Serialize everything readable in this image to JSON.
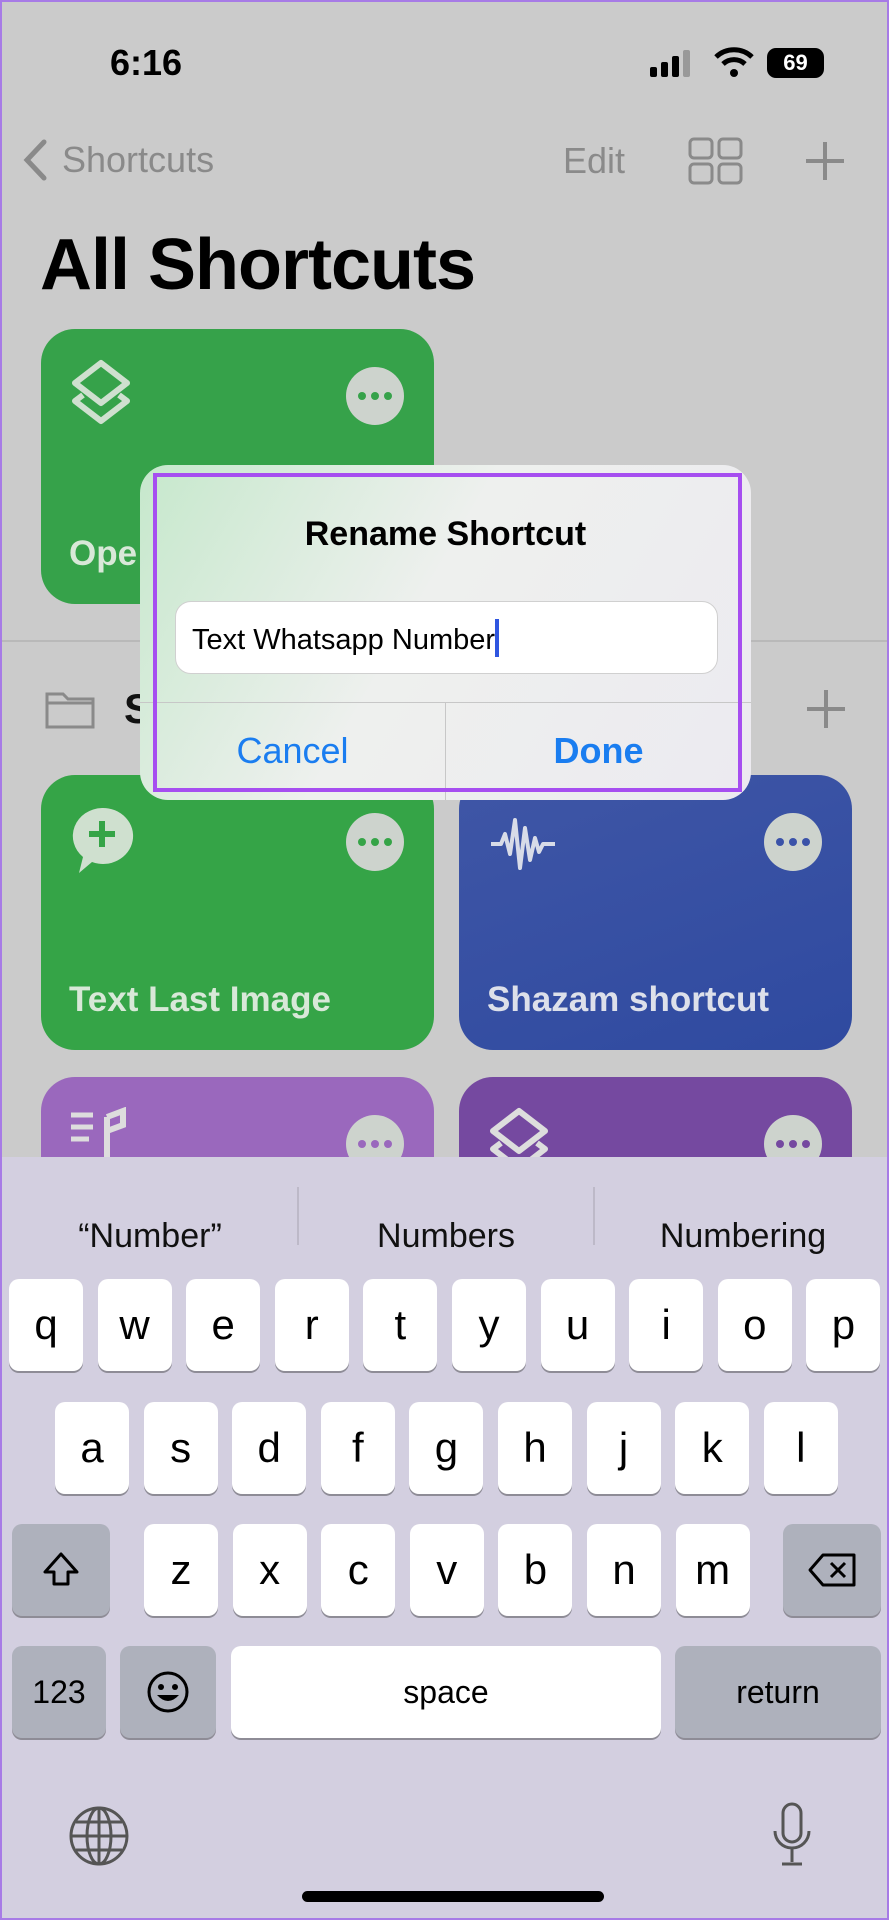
{
  "status": {
    "time": "6:16",
    "battery": "69"
  },
  "nav": {
    "back_label": "Shortcuts",
    "edit_label": "Edit"
  },
  "page_title": "All Shortcuts",
  "cards": [
    {
      "label": "Ope",
      "color": "#36a24a",
      "icon": "layers-icon"
    },
    {
      "label": "Text Last Image",
      "color": "#35a447",
      "icon": "message-plus-icon"
    },
    {
      "label": "Shazam shortcut",
      "color": "#3a52a8",
      "icon": "waveform-icon"
    },
    {
      "label": "",
      "color": "#9a68bd",
      "icon": "music-list-icon"
    },
    {
      "label": "",
      "color": "#7549a0",
      "icon": "layers-icon"
    }
  ],
  "folder": {
    "label": "S"
  },
  "dialog": {
    "title": "Rename Shortcut",
    "input_value": "Text Whatsapp Number",
    "cancel": "Cancel",
    "done": "Done"
  },
  "keyboard": {
    "suggestions": [
      "“Number”",
      "Numbers",
      "Numbering"
    ],
    "row1": [
      "q",
      "w",
      "e",
      "r",
      "t",
      "y",
      "u",
      "i",
      "o",
      "p"
    ],
    "row2": [
      "a",
      "s",
      "d",
      "f",
      "g",
      "h",
      "j",
      "k",
      "l"
    ],
    "row3": [
      "z",
      "x",
      "c",
      "v",
      "b",
      "n",
      "m"
    ],
    "numbers": "123",
    "space": "space",
    "return": "return"
  },
  "colors": {
    "accent": "#1a7df0",
    "highlight": "#a64ef0"
  }
}
